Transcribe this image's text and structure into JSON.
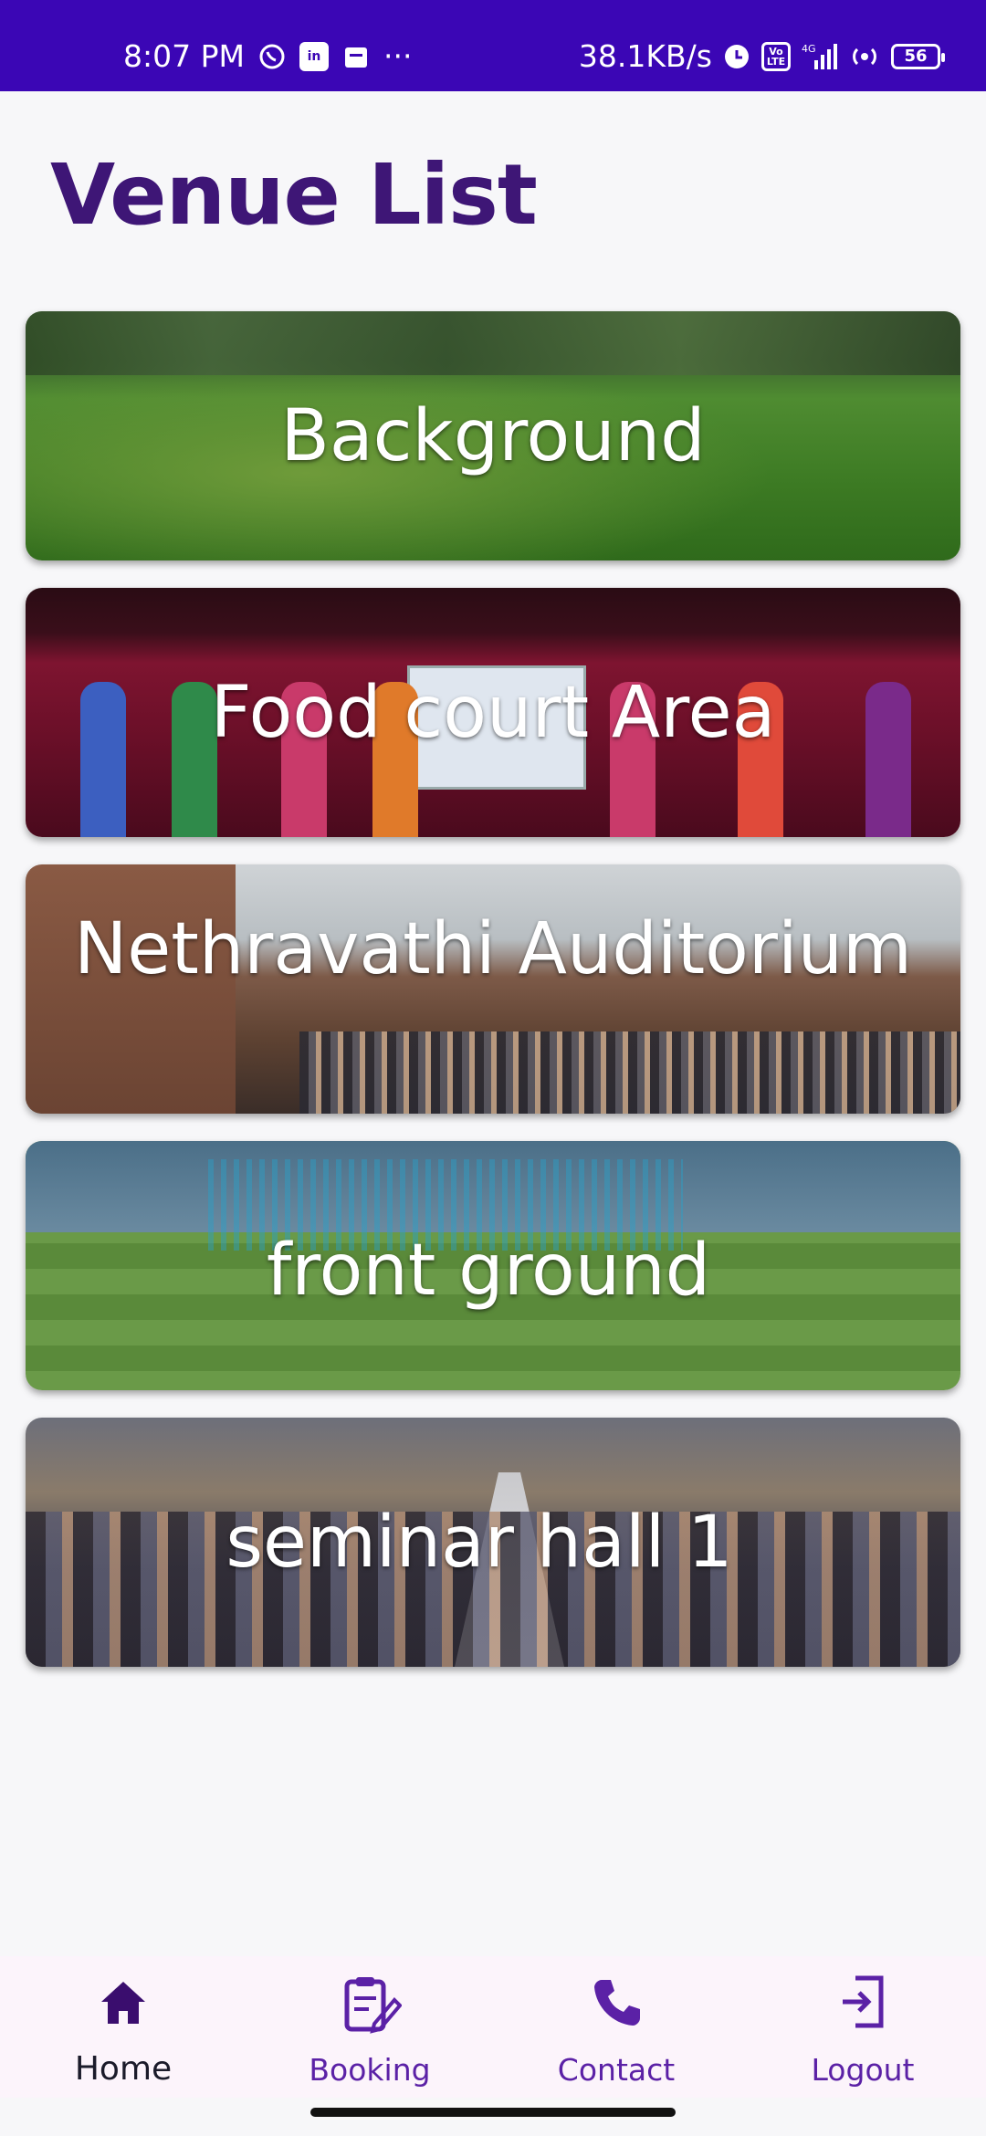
{
  "status_bar": {
    "time": "8:07 PM",
    "speed": "38.1KB/s",
    "network": "4G",
    "battery": "56",
    "volte": "Vo LTE",
    "icons": [
      "whatsapp-icon",
      "linkedin-icon",
      "calendar-icon",
      "more-dots-icon",
      "clock-icon",
      "volte-icon",
      "signal-icon",
      "hotspot-icon",
      "battery-icon"
    ]
  },
  "page": {
    "title": "Venue List"
  },
  "venues": [
    {
      "label": "Background",
      "scene": "open ground aerial"
    },
    {
      "label": "Food court Area",
      "scene": "stage dance performance"
    },
    {
      "label": "Nethravathi Auditorium",
      "scene": "auditorium with speaker"
    },
    {
      "label": "front ground",
      "scene": "sports field with nets"
    },
    {
      "label": "seminar hall 1",
      "scene": "seminar hall audience"
    }
  ],
  "bottom_nav": {
    "items": [
      {
        "label": "Home",
        "icon": "home-icon",
        "active": true
      },
      {
        "label": "Booking",
        "icon": "booking-icon",
        "active": false
      },
      {
        "label": "Contact",
        "icon": "phone-icon",
        "active": false
      },
      {
        "label": "Logout",
        "icon": "logout-icon",
        "active": false
      }
    ]
  },
  "colors": {
    "status_bar": "#3b06b5",
    "title": "#3e1676",
    "nav_accent": "#5b21a6",
    "nav_background": "#fcf4fb"
  }
}
